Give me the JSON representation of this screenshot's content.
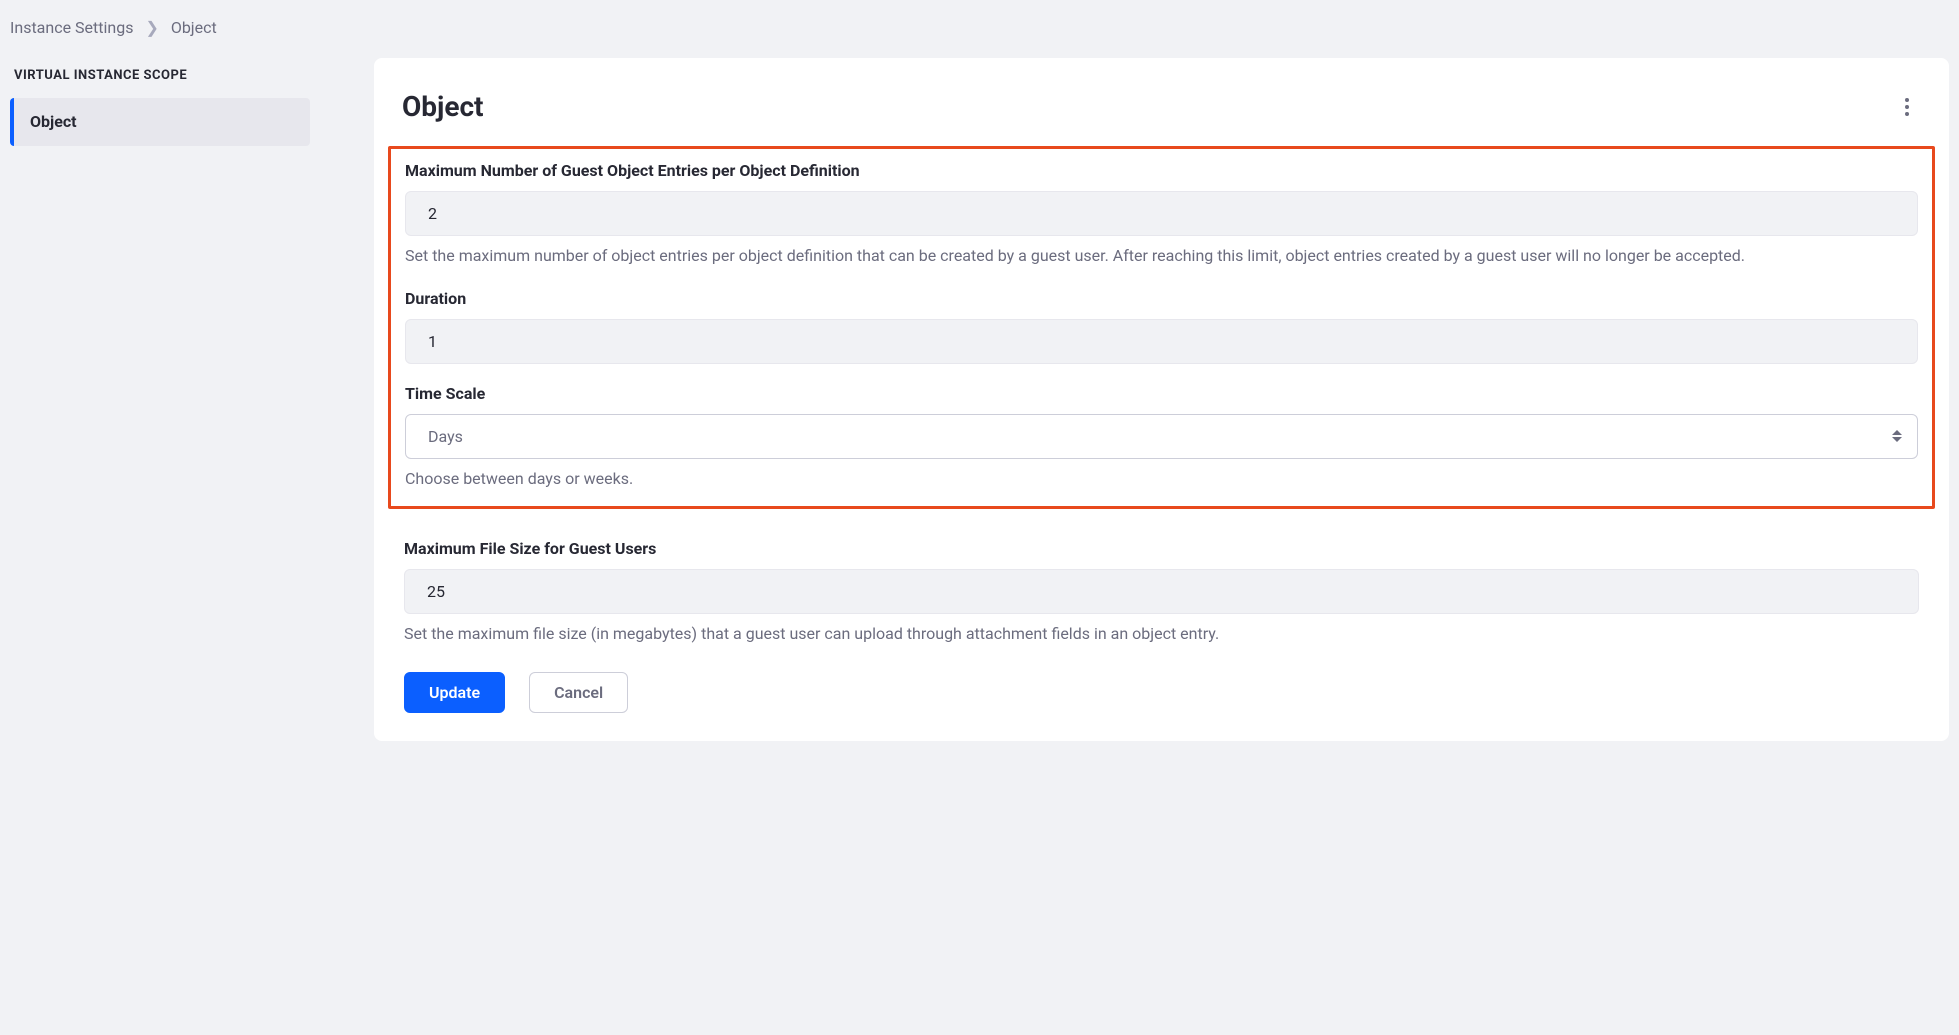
{
  "breadcrumb": {
    "parent": "Instance Settings",
    "current": "Object"
  },
  "sidebar": {
    "heading": "VIRTUAL INSTANCE SCOPE",
    "items": [
      {
        "label": "Object"
      }
    ]
  },
  "panel": {
    "title": "Object"
  },
  "form": {
    "maxGuestEntries": {
      "label": "Maximum Number of Guest Object Entries per Object Definition",
      "value": "2",
      "help": "Set the maximum number of object entries per object definition that can be created by a guest user. After reaching this limit, object entries created by a guest user will no longer be accepted."
    },
    "duration": {
      "label": "Duration",
      "value": "1"
    },
    "timeScale": {
      "label": "Time Scale",
      "selected": "Days",
      "help": "Choose between days or weeks."
    },
    "maxFileSize": {
      "label": "Maximum File Size for Guest Users",
      "value": "25",
      "help": "Set the maximum file size (in megabytes) that a guest user can upload through attachment fields in an object entry."
    }
  },
  "actions": {
    "update_label": "Update",
    "cancel_label": "Cancel"
  }
}
